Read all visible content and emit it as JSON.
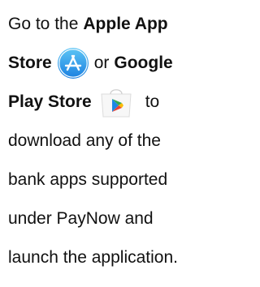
{
  "instructions": {
    "line1": {
      "prefix": "Go to the ",
      "bold": "Apple App"
    },
    "line2": {
      "bold": "Store",
      "suffix": "or",
      "bold2": "Google"
    },
    "line3": {
      "bold": "Play Store",
      "suffix": "to"
    },
    "line4": "download any of the",
    "line5": "bank apps supported",
    "line6": "under PayNow and",
    "line7": "launch the application."
  },
  "icons": {
    "app_store": "app-store-icon",
    "google_play": "google-play-icon"
  },
  "colors": {
    "app_store_gradient_top": "#5ec6f5",
    "app_store_gradient_bottom": "#1a7fe0",
    "play_green": "#34a853",
    "play_blue": "#1e88e5",
    "play_red": "#ea4335",
    "play_yellow": "#fbbc05"
  }
}
